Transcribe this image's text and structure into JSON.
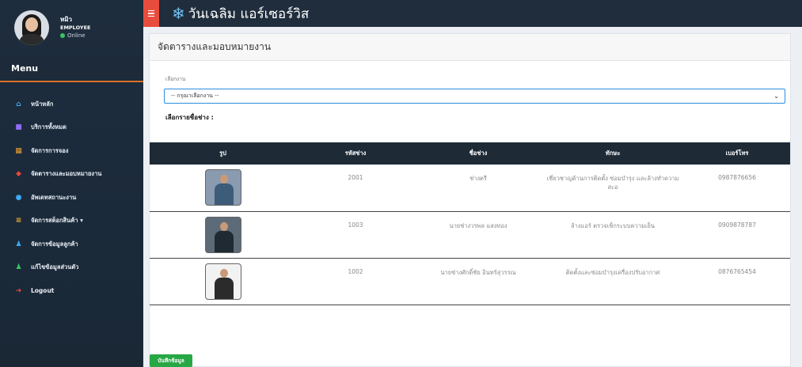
{
  "user": {
    "name": "หมิว",
    "role": "EMPLOYEE",
    "status": "Online"
  },
  "sidebar": {
    "menu_title": "Menu",
    "items": [
      {
        "label": "หน้าหลัก",
        "icon": "home-icon",
        "glyph": "⌂",
        "color": "#3fa9f5"
      },
      {
        "label": "บริการทั้งหมด",
        "icon": "briefcase-icon",
        "glyph": "■",
        "color": "#8e6cf2"
      },
      {
        "label": "จัดการการจอง",
        "icon": "calendar-icon",
        "glyph": "▦",
        "color": "#f0a030"
      },
      {
        "label": "จัดตารางและมอบหมายงาน",
        "icon": "book-icon",
        "glyph": "◆",
        "color": "#e8463c"
      },
      {
        "label": "อัพเดทสถานะงาน",
        "icon": "check-circle-icon",
        "glyph": "●",
        "color": "#3fa9f5"
      },
      {
        "label": "จัดการสต็อกสินค้า ▾",
        "icon": "database-icon",
        "glyph": "≡",
        "color": "#f0b030"
      },
      {
        "label": "จัดการข้อมูลลูกค้า",
        "icon": "users-icon",
        "glyph": "♟",
        "color": "#3fa9f5"
      },
      {
        "label": "แก้ไขข้อมูลส่วนตัว",
        "icon": "user-icon",
        "glyph": "♟",
        "color": "#37c563"
      },
      {
        "label": "Logout",
        "icon": "sign-out-icon",
        "glyph": "➜",
        "color": "#e8463c"
      }
    ]
  },
  "topbar": {
    "brand": "วันเฉลิม แอร์เซอร์วิส"
  },
  "page": {
    "title": "จัดตารางและมอบหมายงาน",
    "job_label": "เลือกงาน",
    "job_select_value": "-- กรุณาเลือกงาน --",
    "pick_technician_label": "เลือกรายชื่อช่าง :",
    "save_button": "บันทึกข้อมูล"
  },
  "table": {
    "headers": [
      "รูป",
      "รหัสช่าง",
      "ชื่อช่าง",
      "ทักษะ",
      "เบอร์โทร"
    ],
    "rows": [
      {
        "id": "2001",
        "name": "ช่างตรี",
        "skill": "เชี่ยวชาญด้านการติดตั้ง ซ่อมบำรุง และล้างทำความสะอ",
        "phone": "0987876656"
      },
      {
        "id": "1003",
        "name": "นายช่างวรพล แสงทอง",
        "skill": "ล้างแอร์ ตรวจเช็กระบบความเย็น",
        "phone": "0909878787"
      },
      {
        "id": "1002",
        "name": "นายช่างศักดิ์ชัย อินทร์สุวรรณ",
        "skill": "ติดตั้งและซ่อมบำรุงเครื่องปรับอากาศ",
        "phone": "0876765454"
      }
    ]
  }
}
